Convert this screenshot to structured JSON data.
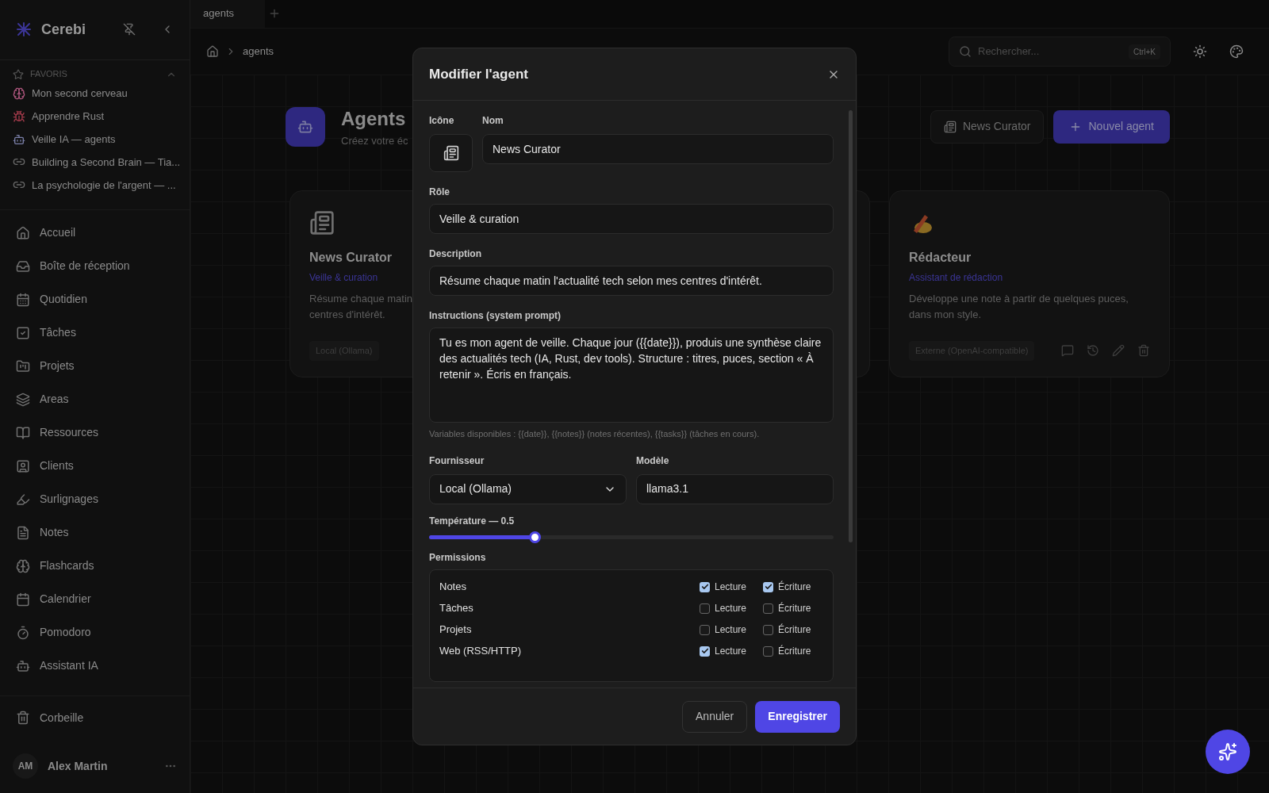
{
  "sidebar": {
    "brand": "Cerebi",
    "favorites_title": "FAVORIS",
    "favorites": [
      {
        "kind": "brain",
        "label": "Mon second cerveau"
      },
      {
        "kind": "crab",
        "label": "Apprendre Rust"
      },
      {
        "kind": "robot",
        "label": "Veille IA — agents"
      },
      {
        "kind": "link",
        "label": "Building a Second Brain — Tia..."
      },
      {
        "kind": "link",
        "label": "La psychologie de l'argent — ..."
      }
    ],
    "nav": [
      {
        "label": "Accueil"
      },
      {
        "label": "Boîte de réception"
      },
      {
        "label": "Quotidien"
      },
      {
        "label": "Tâches"
      },
      {
        "label": "Projets"
      },
      {
        "label": "Areas"
      },
      {
        "label": "Ressources"
      },
      {
        "label": "Clients"
      },
      {
        "label": "Surlignages"
      },
      {
        "label": "Notes"
      },
      {
        "label": "Flashcards"
      },
      {
        "label": "Calendrier"
      },
      {
        "label": "Pomodoro"
      },
      {
        "label": "Assistant IA"
      }
    ],
    "trash": "Corbeille",
    "user": {
      "initials": "AM",
      "name": "Alex Martin"
    }
  },
  "tabs": [
    {
      "label": "agents",
      "selected": true
    }
  ],
  "breadcrumb": [
    "agents"
  ],
  "search": {
    "placeholder": "Rechercher...",
    "shortcut": "Ctrl+K"
  },
  "page": {
    "title": "Agents",
    "subtitle": "Créez votre éc",
    "buttons": [
      {
        "kind": "secondary",
        "label": "News Curator"
      },
      {
        "kind": "primary",
        "label": "Nouvel agent"
      }
    ],
    "cards": [
      {
        "kind": "news",
        "title": "News Curator",
        "role": "Veille & curation",
        "description": [
          "Résume chaque matin",
          "centres d'intérêt."
        ],
        "provider": "Local (Ollama)"
      },
      {
        "kind": "hidden"
      },
      {
        "kind": "writer",
        "title": "Rédacteur",
        "role": "Assistant de rédaction",
        "description": [
          "Développe une note à partir de quelques puces,",
          "dans mon style."
        ],
        "provider": "Externe (OpenAI-compatible)"
      }
    ]
  },
  "dialog": {
    "title": "Modifier l'agent",
    "icon_label": "Icône",
    "name_label": "Nom",
    "name": "News Curator",
    "role_label": "Rôle",
    "role": "Veille & curation",
    "description_label": "Description",
    "description": "Résume chaque matin l'actualité tech selon mes centres d'intérêt.",
    "instructions_label": "Instructions (system prompt)",
    "instructions": "Tu es mon agent de veille. Chaque jour ({{date}}), produis une synthèse claire des actualités tech (IA, Rust, dev tools). Structure : titres, puces, section « À retenir ». Écris en français.",
    "hint": "Variables disponibles : {{date}}, {{notes}} (notes récentes), {{tasks}} (tâches en cours).",
    "provider_label": "Fournisseur",
    "provider": "Local (Ollama)",
    "model_label": "Modèle",
    "model": "llama3.1",
    "temperature_label": "Température — 0.5",
    "temperature": {
      "level": 0.26
    },
    "permissions_label": "Permissions",
    "permissions": [
      {
        "name": "Notes",
        "read": {
          "label": "Lecture",
          "checked": true
        },
        "write": {
          "label": "Écriture",
          "checked": true
        }
      },
      {
        "name": "Tâches",
        "read": {
          "label": "Lecture",
          "checked": false
        },
        "write": {
          "label": "Écriture",
          "checked": false
        }
      },
      {
        "name": "Projets",
        "read": {
          "label": "Lecture",
          "checked": false
        },
        "write": {
          "label": "Écriture",
          "checked": false
        }
      },
      {
        "name": "Web (RSS/HTTP)",
        "read": {
          "label": "Lecture",
          "checked": true
        },
        "write": {
          "label": "Écriture",
          "checked": false
        }
      }
    ],
    "cancel": "Annuler",
    "save": "Enregistrer"
  }
}
